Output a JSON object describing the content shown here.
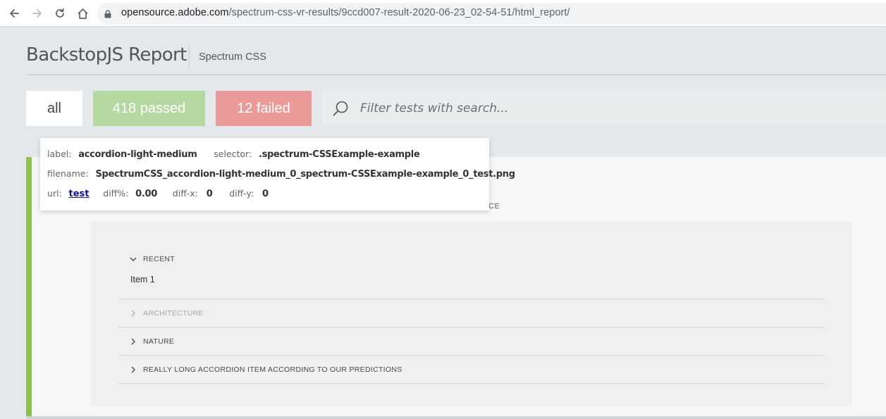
{
  "browser": {
    "url_domain": "opensource.adobe.com",
    "url_path": "/spectrum-css-vr-results/9ccd007-result-2020-06-23_02-54-51/html_report/"
  },
  "header": {
    "title": "BackstopJS Report",
    "subtitle": "Spectrum CSS"
  },
  "filters": {
    "all_label": "all",
    "passed_label": "418 passed",
    "failed_label": "12 failed",
    "search_placeholder": "Filter tests with search..."
  },
  "info": {
    "label_key": "label:",
    "label_value": "accordion-light-medium",
    "selector_key": "selector:",
    "selector_value": ".spectrum-CSSExample-example",
    "filename_key": "filename:",
    "filename_value": "SpectrumCSS_accordion-light-medium_0_spectrum-CSSExample-example_0_test.png",
    "url_key": "url:",
    "url_value": "test",
    "diff_key": "diff%:",
    "diff_value": "0.00",
    "diffx_key": "diff-x:",
    "diffx_value": "0",
    "diffy_key": "diff-y:",
    "diffy_value": "0"
  },
  "card": {
    "obscured_fragment": "CE"
  },
  "accordion": {
    "items": [
      {
        "label": "RECENT",
        "expanded": true,
        "disabled": false,
        "content": "Item 1"
      },
      {
        "label": "ARCHITECTURE",
        "expanded": false,
        "disabled": true
      },
      {
        "label": "NATURE",
        "expanded": false,
        "disabled": false
      },
      {
        "label": "REALLY LONG ACCORDION ITEM ACCORDING TO OUR PREDICTIONS",
        "expanded": false,
        "disabled": false
      }
    ]
  },
  "colors": {
    "pass_accent": "#8cc152",
    "passed_button": "#b5d8a1",
    "failed_button": "#e99a99",
    "link": "#1a0dab"
  }
}
